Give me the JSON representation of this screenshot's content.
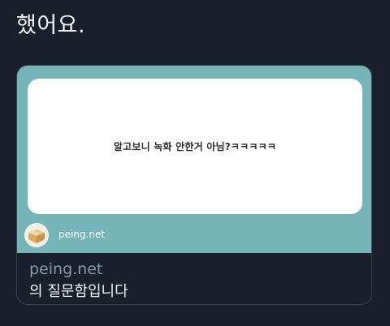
{
  "tweet": {
    "text": "했어요."
  },
  "card": {
    "question": "알고보니 녹화 안한거 아님?ㅋㅋㅋㅋㅋ",
    "brand": "peing.net",
    "domain": "peing.net",
    "title": "의 질문함입니다"
  },
  "colors": {
    "background": "#19202b",
    "card_teal": "#76b5b7",
    "question_panel": "#ffffff",
    "muted_text": "#8b98a5",
    "text": "#f4f6f8"
  },
  "icons": {
    "avatar": "cardboard-box-icon"
  }
}
